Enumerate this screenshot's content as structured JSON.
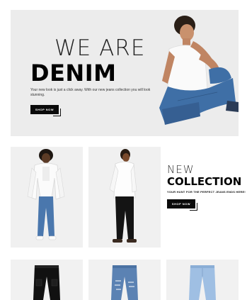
{
  "hero": {
    "line1": "WE ARE",
    "line2": "DENIM",
    "description": "Your new look is just a click away. With our new jeans collection you will look stunning.",
    "button": "SHOP NOW"
  },
  "collection": {
    "line1": "NEW",
    "line2": "COLLECTION",
    "subtitle": "YOUR HUNT FOR THE PERFECT JEANS ENDS HERE!",
    "button": "SHOP NOW"
  },
  "colors": {
    "background": "#ffffff",
    "panel": "#ececec",
    "button": "#0a0a0a",
    "denim": "#3f6fa6"
  },
  "icons": {
    "hero_model": "man-in-white-tshirt-and-jeans-image",
    "photo_left": "woman-in-white-denim-jacket-image",
    "photo_right": "man-in-white-shirt-black-jeans-image",
    "product_1": "black-cargo-jeans-image",
    "product_2": "ripped-blue-jeans-image",
    "product_3": "light-blue-jeans-image"
  }
}
